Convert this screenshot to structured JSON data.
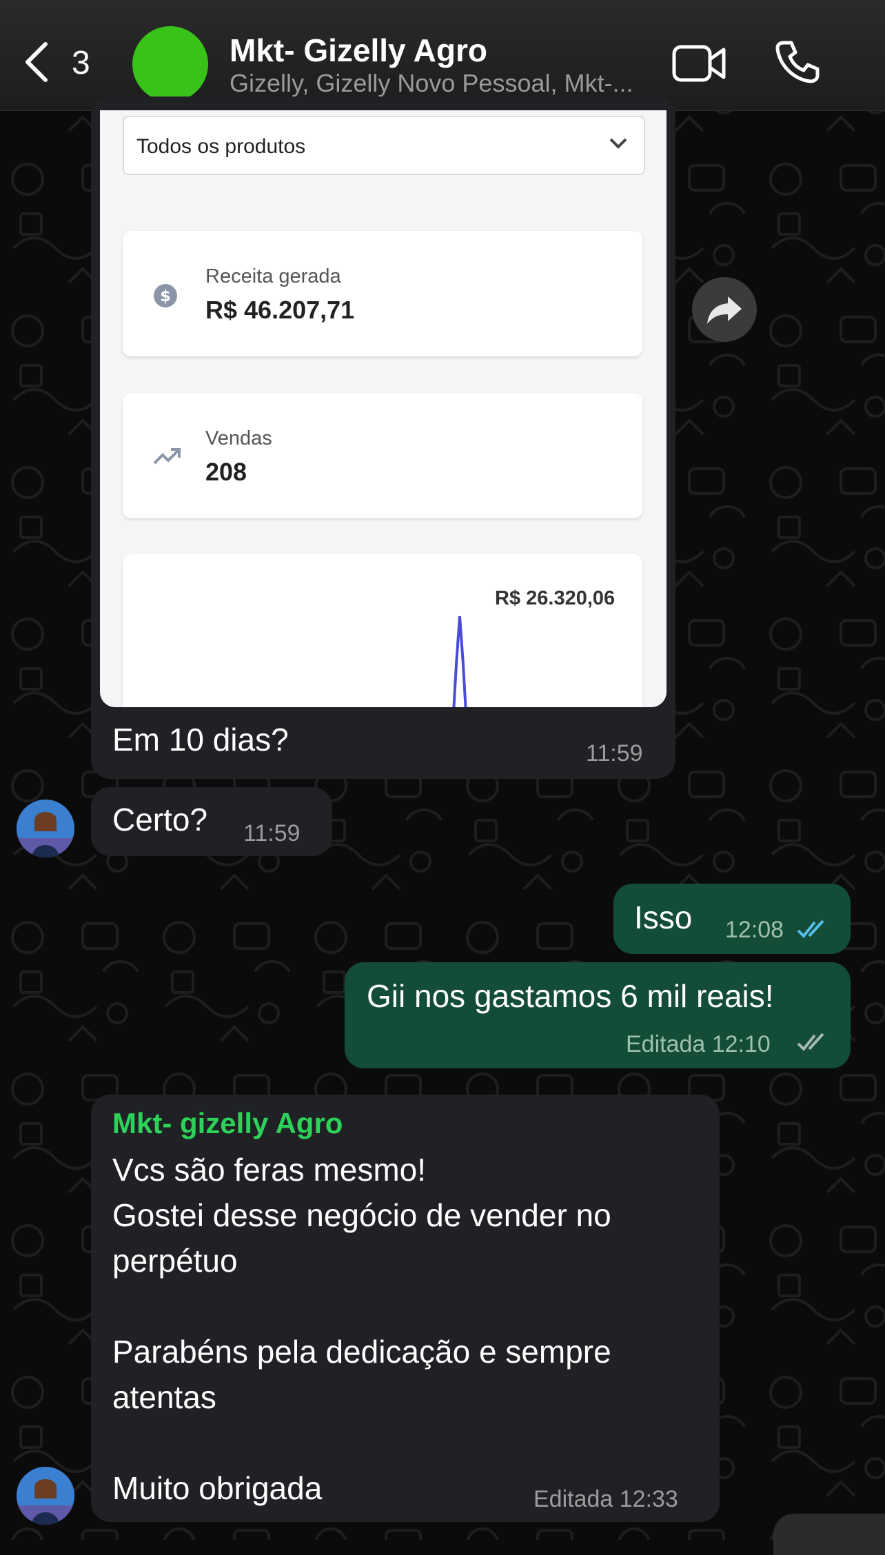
{
  "header": {
    "back_count": "3",
    "title": "Mkt- Gizelly Agro",
    "subtitle": "Gizelly, Gizelly Novo Pessoal, Mkt-..."
  },
  "shared_image": {
    "dropdown_label": "Todos os produtos",
    "revenue_label": "Receita gerada",
    "revenue_value": "R$ 46.207,71",
    "sales_label": "Vendas",
    "sales_value": "208",
    "chart_peak_label": "R$ 26.320,06"
  },
  "messages": [
    {
      "text": "Em 10 dias?",
      "time": "11:59"
    },
    {
      "text": "Certo?",
      "time": "11:59"
    },
    {
      "text": "Isso",
      "time": "12:08"
    },
    {
      "text": "Gii nos gastamos 6 mil reais!",
      "time": "Editada 12:10"
    },
    {
      "sender": "Mkt- gizelly Agro",
      "lines": [
        "Vcs são feras mesmo!",
        "Gostei desse negócio de vender no",
        "perpétuo",
        "Parabéns pela dedicação e sempre",
        "atentas",
        "Muito obrigada"
      ],
      "time": "Editada 12:33"
    }
  ],
  "colors": {
    "outgoing_bubble": "#134d37",
    "incoming_bubble": "#202124",
    "sender_name": "#2ed159",
    "read_ticks": "#53bdeb",
    "group_avatar": "#39c21a"
  },
  "icons": [
    "chevron-left-icon",
    "video-call-icon",
    "phone-icon",
    "forward-icon",
    "dollar-icon",
    "trending-up-icon",
    "chevron-down-icon",
    "double-check-icon"
  ]
}
